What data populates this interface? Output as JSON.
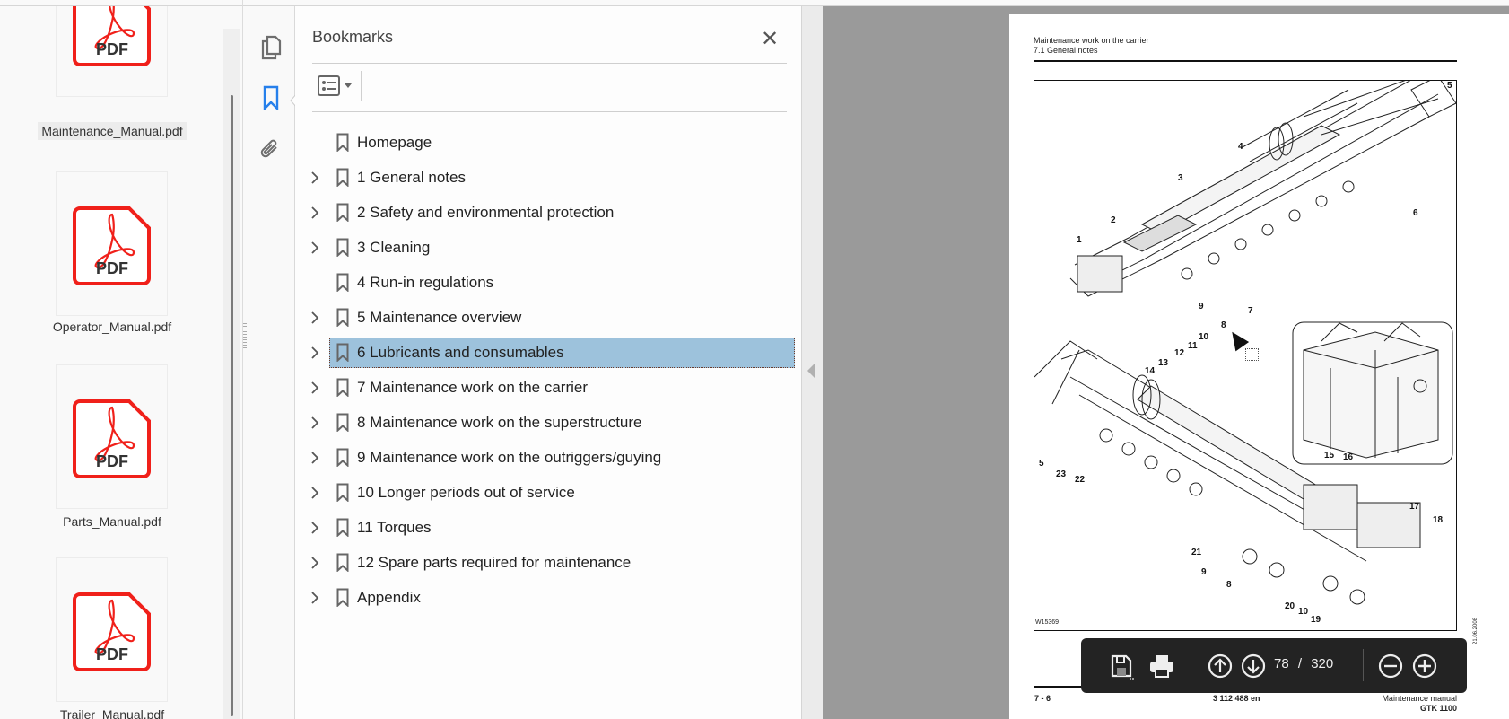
{
  "files": [
    {
      "name": "Maintenance_Manual.pdf",
      "selected": true,
      "icon_label": "PDF"
    },
    {
      "name": "Operator_Manual.pdf",
      "selected": false,
      "icon_label": "PDF"
    },
    {
      "name": "Parts_Manual.pdf",
      "selected": false,
      "icon_label": "PDF"
    },
    {
      "name": "Trailer_Manual.pdf",
      "selected": false,
      "icon_label": "PDF"
    }
  ],
  "rail": {
    "icons": [
      "pages-icon",
      "bookmark-icon",
      "attachment-icon"
    ],
    "active_color": "#2680eb"
  },
  "bookmarks": {
    "title": "Bookmarks",
    "close_icon": "close-icon",
    "options_icon": "bookmark-options-icon",
    "items": [
      {
        "label": "Homepage",
        "expandable": false
      },
      {
        "label": "1 General notes",
        "expandable": true
      },
      {
        "label": "2 Safety and environmental protection",
        "expandable": true
      },
      {
        "label": "3 Cleaning",
        "expandable": true
      },
      {
        "label": "4 Run-in regulations",
        "expandable": false
      },
      {
        "label": "5 Maintenance overview",
        "expandable": true
      },
      {
        "label": "6 Lubricants and consumables",
        "expandable": true,
        "selected": true
      },
      {
        "label": "7 Maintenance work on the carrier",
        "expandable": true
      },
      {
        "label": "8 Maintenance work on the superstructure",
        "expandable": true
      },
      {
        "label": "9 Maintenance work on the outriggers/guying",
        "expandable": true
      },
      {
        "label": "10 Longer periods out of service",
        "expandable": true
      },
      {
        "label": "11 Torques",
        "expandable": true
      },
      {
        "label": "12 Spare parts required for maintenance",
        "expandable": true
      },
      {
        "label": "Appendix",
        "expandable": true
      }
    ],
    "selected_color": "#9dc2dc"
  },
  "page": {
    "header_line1": "Maintenance work on the carrier",
    "header_line2": "7.1 General notes",
    "figure_id": "W15369",
    "callouts": [
      "5",
      "4",
      "3",
      "6",
      "2",
      "1",
      "7",
      "9",
      "8",
      "10",
      "11",
      "12",
      "13",
      "14",
      "5",
      "23",
      "22",
      "15",
      "16",
      "17",
      "18",
      "21",
      "9",
      "8",
      "20",
      "10",
      "19"
    ],
    "footer_left": "7 - 6",
    "footer_center": "3 112 488 en",
    "footer_right1": "Maintenance manual",
    "footer_right2": "GTK 1100",
    "side_date": "21.06.2008"
  },
  "toolbar": {
    "current_page": "78",
    "separator": "/",
    "total_pages": "320",
    "icons": [
      "save-icon",
      "print-icon",
      "previous-page-icon",
      "next-page-icon",
      "zoom-out-icon",
      "zoom-in-icon"
    ]
  }
}
